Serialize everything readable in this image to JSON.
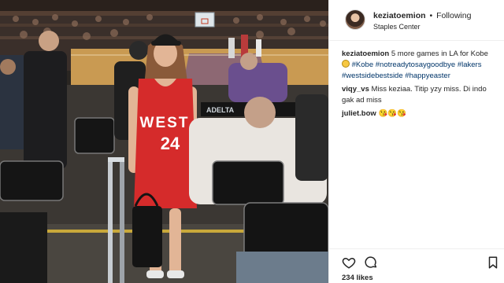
{
  "post": {
    "username": "keziatoemion",
    "separator": "•",
    "follow_status": "Following",
    "location": "Staples Center",
    "caption": {
      "username": "keziatoemion",
      "text": "5 more games in LA for Kobe",
      "emoji_icon": "grinning-face-icon",
      "hashtags": [
        "#Kobe",
        "#notreadytosaygoodbye",
        "#lakers",
        "#westsidebestside",
        "#happyeaster"
      ]
    },
    "comments": [
      {
        "username": "viqy_vs",
        "text": "Miss keziaa. Titip yzy miss. Di indo gak ad miss"
      },
      {
        "username": "juliet.bow",
        "text": "😘😘😘"
      }
    ],
    "likes": "234 likes",
    "icons": {
      "like": "heart-icon",
      "comment": "comment-icon",
      "save": "bookmark-icon"
    }
  },
  "photo": {
    "jersey_lettering": "WEST",
    "jersey_number": "24",
    "arena_sign": "ADELTA"
  },
  "colors": {
    "accent_link": "#003569",
    "jersey_red": "#d52b2b",
    "court_wood": "#c99a52"
  }
}
